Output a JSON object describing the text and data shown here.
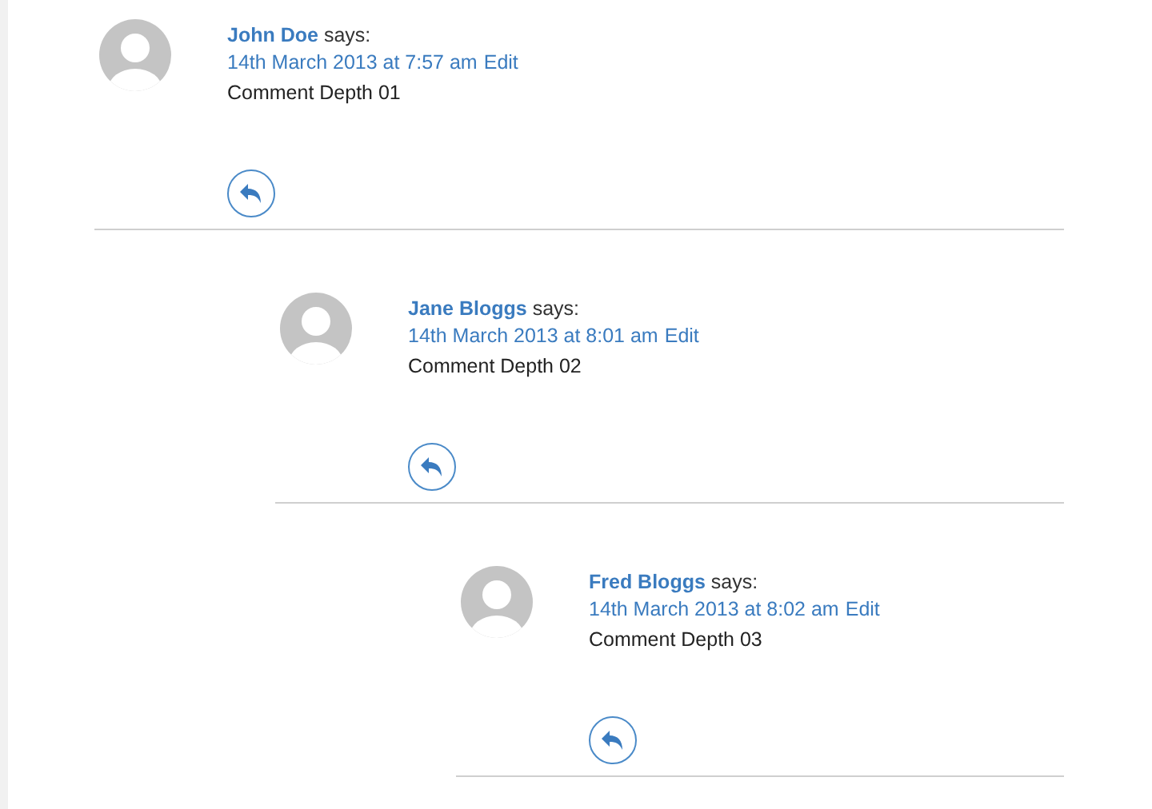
{
  "comments": [
    {
      "author": "John Doe",
      "says": "says:",
      "date": "14th March 2013 at 7:57 am",
      "edit": "Edit",
      "body": "Comment Depth 01",
      "children": [
        {
          "author": "Jane Bloggs",
          "says": "says:",
          "date": "14th March 2013 at 8:01 am",
          "edit": "Edit",
          "body": "Comment Depth 02",
          "children": [
            {
              "author": "Fred Bloggs",
              "says": "says:",
              "date": "14th March 2013 at 8:02 am",
              "edit": "Edit",
              "body": "Comment Depth 03"
            }
          ]
        }
      ]
    }
  ]
}
